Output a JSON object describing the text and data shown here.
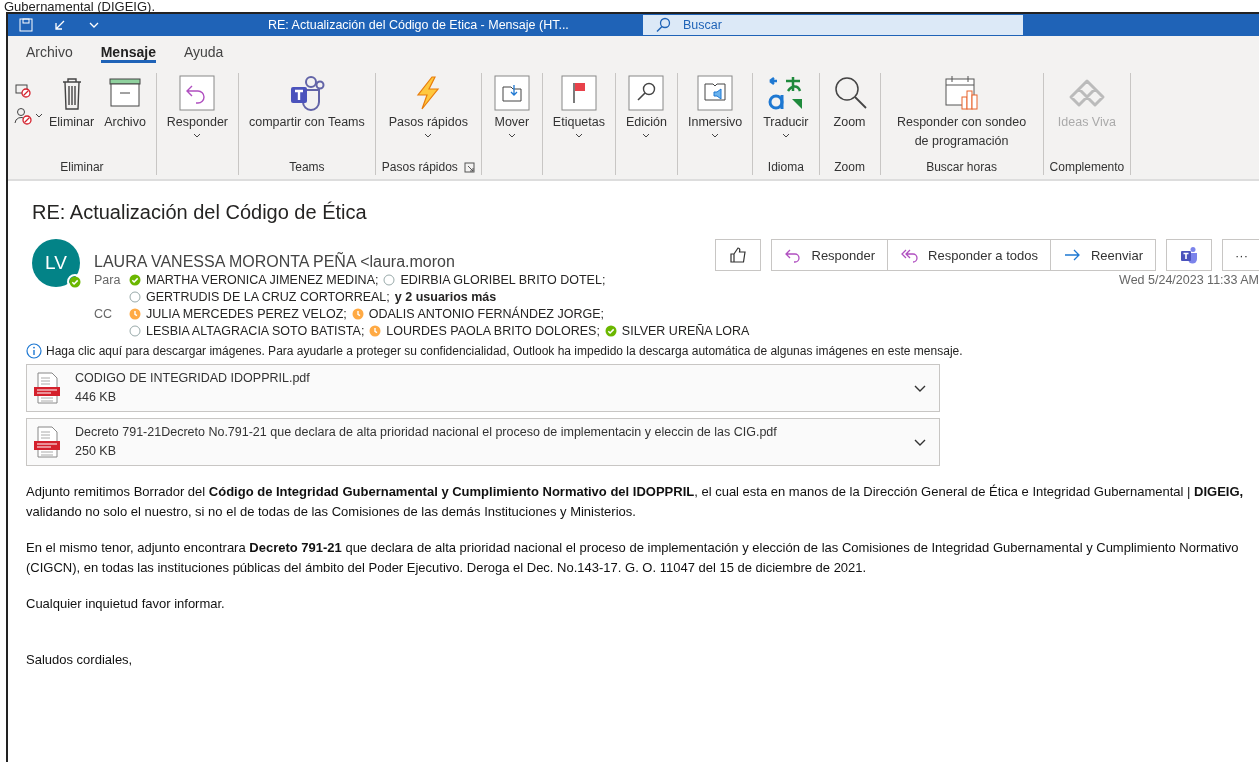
{
  "top_caption": "Gubernamental (DIGEIG).",
  "window": {
    "title": "RE: Actualización del Código de Etica  -  Mensaje (HT...",
    "search": {
      "placeholder": "Buscar"
    }
  },
  "ribbon_tabs": [
    {
      "label": "Archivo",
      "selected": false
    },
    {
      "label": "Mensaje",
      "selected": true
    },
    {
      "label": "Ayuda",
      "selected": false
    }
  ],
  "ribbon_groups": [
    {
      "label": "Eliminar",
      "buttons": [
        {
          "kind": "mini"
        },
        {
          "kind": "trash",
          "label": "Eliminar",
          "caret": false,
          "disabled": false
        },
        {
          "kind": "archive",
          "label": "Archivo",
          "caret": false,
          "disabled": false
        }
      ]
    },
    {
      "buttons": [
        {
          "kind": "reply",
          "label": "Responder",
          "caret": true,
          "disabled": false
        }
      ]
    },
    {
      "label": "Teams",
      "buttons": [
        {
          "kind": "teams",
          "label": "compartir con Teams",
          "caret": false,
          "disabled": false
        }
      ]
    },
    {
      "label": "Pasos rápidos",
      "launcher": true,
      "buttons": [
        {
          "kind": "bolt",
          "label": "Pasos rápidos",
          "caret": true,
          "disabled": false
        }
      ]
    },
    {
      "buttons": [
        {
          "kind": "move",
          "label": "Mover",
          "caret": true,
          "disabled": false
        }
      ]
    },
    {
      "buttons": [
        {
          "kind": "flag",
          "label": "Etiquetas",
          "caret": true,
          "disabled": false
        }
      ]
    },
    {
      "buttons": [
        {
          "kind": "find",
          "label": "Edición",
          "caret": true,
          "disabled": false
        }
      ]
    },
    {
      "buttons": [
        {
          "kind": "reader",
          "label": "Inmersivo",
          "caret": true,
          "disabled": false
        }
      ]
    },
    {
      "label": "Idioma",
      "buttons": [
        {
          "kind": "translate",
          "label": "Traducir",
          "caret": true,
          "disabled": false
        }
      ]
    },
    {
      "label": "Zoom",
      "buttons": [
        {
          "kind": "zoom",
          "label": "Zoom",
          "caret": false,
          "disabled": false
        }
      ]
    },
    {
      "label": "Buscar horas",
      "buttons": [
        {
          "kind": "calendar",
          "label": "Responder con sondeo de programación",
          "caret": false,
          "disabled": false
        }
      ]
    },
    {
      "label": "Complemento",
      "buttons": [
        {
          "kind": "ideas",
          "label": "Ideas Viva",
          "caret": false,
          "disabled": true
        }
      ]
    }
  ],
  "message": {
    "subject": "RE: Actualización del Código de Ética",
    "sender": {
      "initials": "LV",
      "name": "LAURA VANESSA MORONTA PEÑA <laura.moron",
      "kind": "available"
    },
    "actions": [
      {
        "kind": "like"
      },
      {
        "kind": "reply",
        "label": "Responder"
      },
      {
        "kind": "reply-all",
        "label": "Responder a todos"
      },
      {
        "kind": "forward",
        "label": "Reenviar"
      },
      {
        "kind": "teams"
      },
      {
        "kind": "more",
        "label": "···"
      }
    ],
    "date": "Wed 5/24/2023 11:33 AM",
    "recipient_groups": [
      {
        "label": "Para",
        "lines": [
          {
            "recipients": [
              {
                "name": "MARTHA VERONICA JIMENEZ MEDINA;",
                "kind": "available"
              },
              {
                "name": "EDIRBIA GLORIBEL BRITO DOTEL;",
                "kind": "unknown"
              }
            ]
          },
          {
            "recipients": [
              {
                "name": "GERTRUDIS DE LA CRUZ CORTORREAL;",
                "kind": "unknown"
              }
            ],
            "more": "y 2 usuarios más"
          }
        ]
      },
      {
        "label": "CC",
        "lines": [
          {
            "recipients": [
              {
                "name": "JULIA MERCEDES PEREZ VELOZ;",
                "kind": "away"
              },
              {
                "name": "ODALIS ANTONIO FERNÁNDEZ JORGE;",
                "kind": "away"
              }
            ]
          },
          {
            "recipients": [
              {
                "name": "LESBIA ALTAGRACIA SOTO BATISTA;",
                "kind": "unknown"
              },
              {
                "name": "LOURDES PAOLA BRITO DOLORES;",
                "kind": "away"
              },
              {
                "name": "SILVER UREÑA LORA",
                "kind": "available"
              }
            ]
          }
        ]
      }
    ],
    "info_bar": "Haga clic aquí para descargar imágenes. Para ayudarle a proteger su confidencialidad, Outlook ha impedido la descarga automática de algunas imágenes en este mensaje.",
    "attachments": [
      {
        "name": "CODIGO DE INTEGRIDAD IDOPPRIL.pdf",
        "size": "446 KB"
      },
      {
        "name": "Decreto 791-21Decreto No.791-21 que declara de alta prioridad nacional el proceso de implementacin y eleccin de las CIG.pdf",
        "size": "250 KB"
      }
    ],
    "body": [
      "Adjunto remitimos Borrador del **Código de Integridad Gubernamental y Cumplimiento Normativo del IDOPPRIL**, el cual esta en manos de la Dirección General de Ética e Integridad Gubernamental | **DIGEIG,** validando no solo el nuestro, si no el de todas de las Comisiones de las demás Instituciones y Ministerios.",
      "En el mismo tenor, adjunto encontrara **Decreto 791-21** que declara de alta prioridad nacional el proceso de implementación y elección de las Comisiones de Integridad Gubernamental y Cumplimiento Normativo (CIGCN), en todas las instituciones públicas del ámbito del Poder Ejecutivo. Deroga el Dec. No.143-17. G. O. 11047 del 15 de diciembre de 2021.",
      "Cualquier inquietud favor informar.",
      "Saludos cordiales,"
    ]
  }
}
